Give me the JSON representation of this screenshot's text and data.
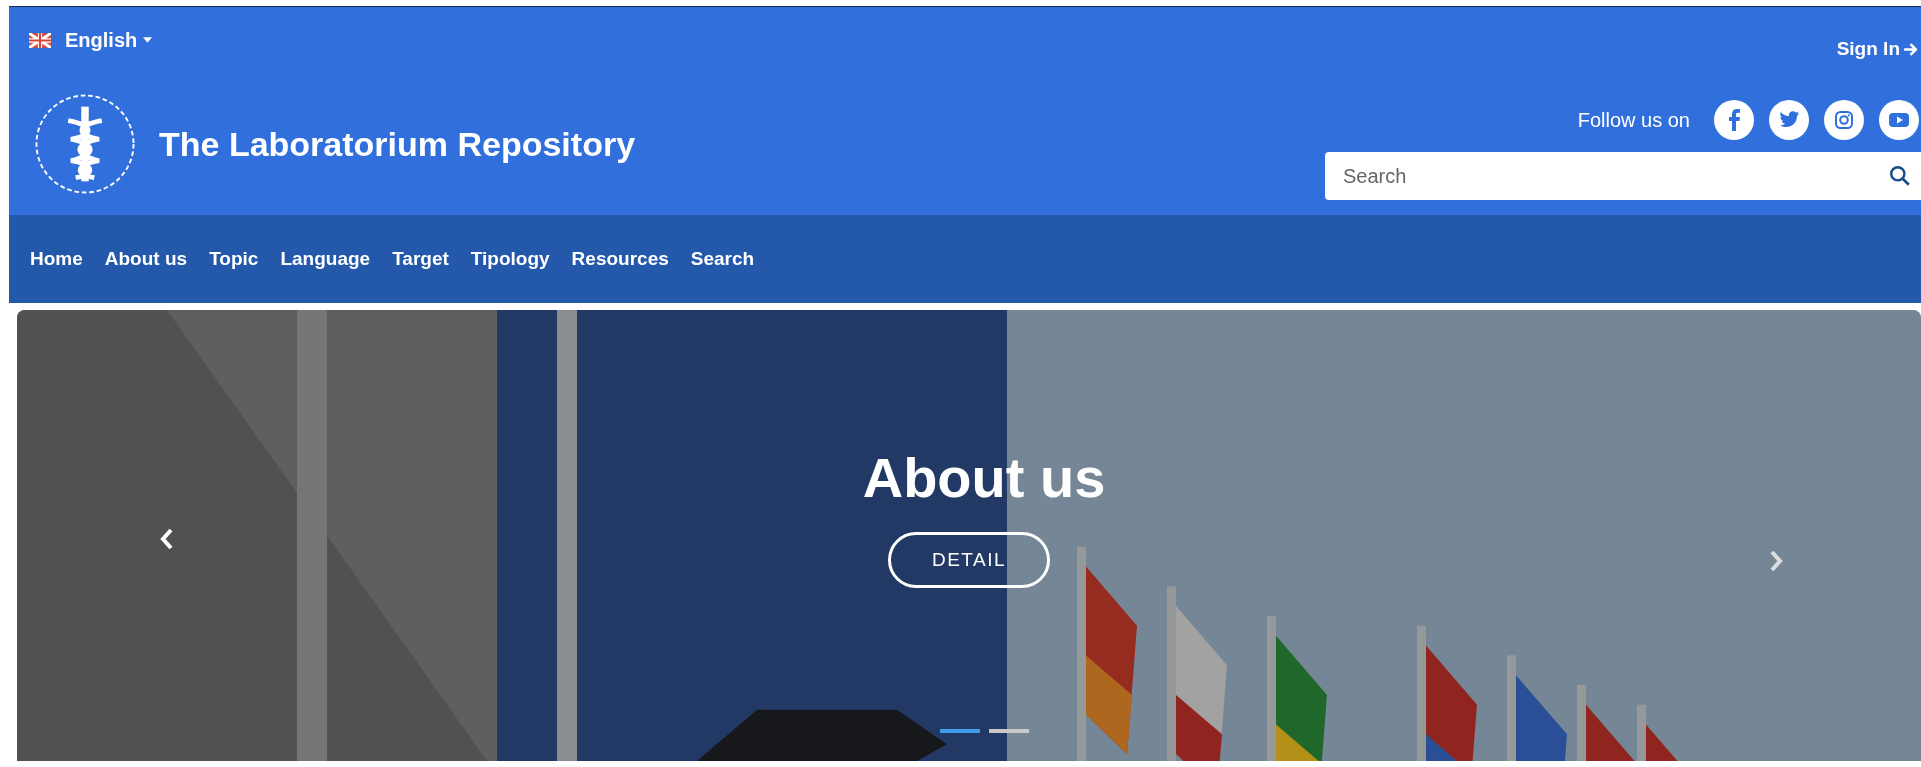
{
  "top_bar": {
    "language": "English",
    "sign_in": "Sign In"
  },
  "brand": {
    "title": "The Laboratorium Repository"
  },
  "social": {
    "label": "Follow us on"
  },
  "search": {
    "placeholder": "Search"
  },
  "nav": {
    "items": [
      "Home",
      "About us",
      "Topic",
      "Language",
      "Target",
      "Tipology",
      "Resources",
      "Search"
    ]
  },
  "carousel": {
    "slide": {
      "kind": "picture",
      "title": "About us",
      "button": "DETAIL"
    },
    "indicators": [
      {
        "selected": true
      },
      {
        "selected": false
      }
    ]
  }
}
